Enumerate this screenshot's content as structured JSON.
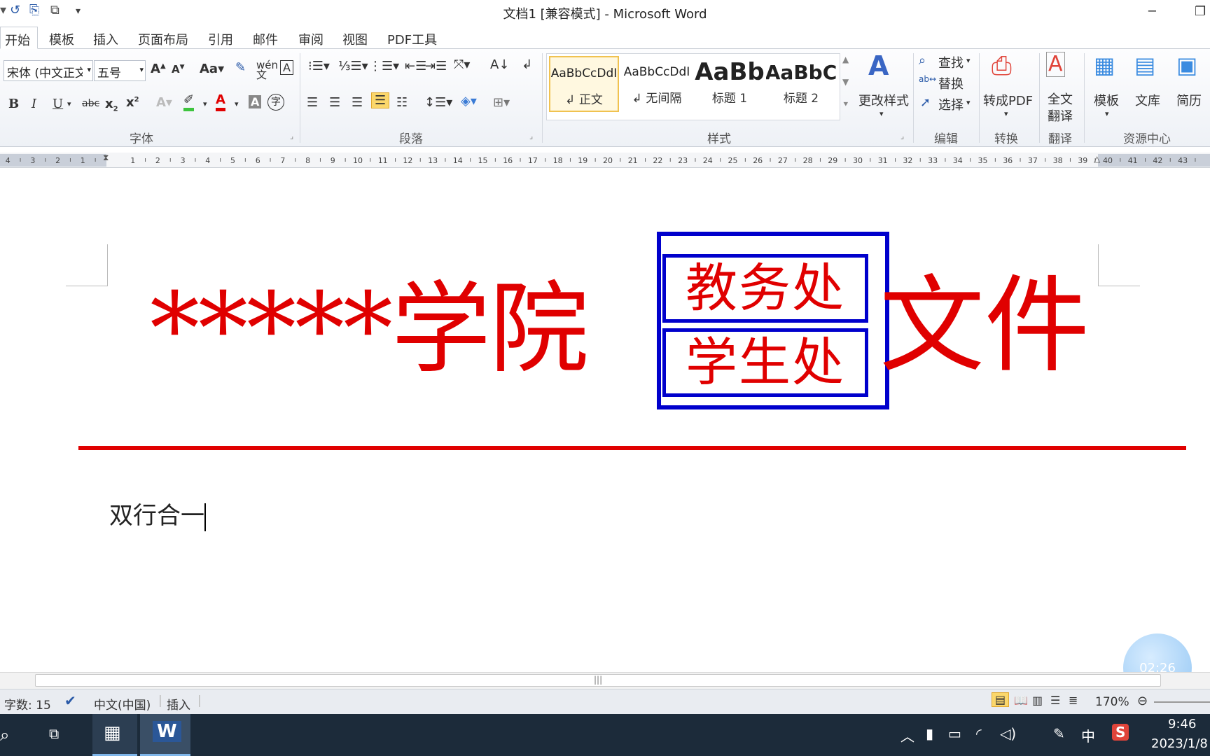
{
  "window": {
    "title": "文档1 [兼容模式] - Microsoft Word"
  },
  "tabs": [
    "开始",
    "模板",
    "插入",
    "页面布局",
    "引用",
    "邮件",
    "审阅",
    "视图",
    "PDF工具"
  ],
  "ribbon": {
    "font_name": "宋体 (中文正文)",
    "font_size": "五号",
    "groups": {
      "font": "字体",
      "paragraph": "段落",
      "styles": "样式",
      "edit": "编辑",
      "convert": "转换",
      "translate": "翻译",
      "resources": "资源中心"
    },
    "styles": [
      {
        "preview": "AaBbCcDdI",
        "name": "↲ 正文"
      },
      {
        "preview": "AaBbCcDdI",
        "name": "↲ 无间隔"
      },
      {
        "preview": "AaBb",
        "name": "标题 1"
      },
      {
        "preview": "AaBbC",
        "name": "标题 2"
      }
    ],
    "change_styles": "更改样式",
    "find": "查找",
    "replace": "替换",
    "select": "选择",
    "to_pdf": "转成PDF",
    "full_translate_1": "全文",
    "full_translate_2": "翻译",
    "templates": "模板",
    "library": "文库",
    "resume": "简历",
    "bold": "B",
    "italic": "I",
    "underline": "U"
  },
  "ruler": {
    "labels": [
      "4",
      "3",
      "2",
      "1",
      "1",
      "2",
      "3",
      "4",
      "5",
      "6",
      "7",
      "8",
      "9",
      "10",
      "11",
      "12",
      "13",
      "14",
      "15",
      "16",
      "17",
      "18",
      "19",
      "20",
      "21",
      "22",
      "23",
      "24",
      "25",
      "26",
      "27",
      "28",
      "29",
      "30",
      "31",
      "32",
      "33",
      "34",
      "35",
      "36",
      "37",
      "38",
      "39",
      "40",
      "41",
      "42",
      "43"
    ]
  },
  "document": {
    "header_left": "*****学院",
    "header_top": "教务处",
    "header_bottom": "学生处",
    "header_right": "文件",
    "body_text": "双行合一"
  },
  "status": {
    "word_count": "字数: 15",
    "language": "中文(中国)",
    "mode": "插入",
    "zoom": "170%"
  },
  "timer": "02:26",
  "taskbar": {
    "time": "9:46",
    "date": "2023/1/8",
    "ime": "中"
  },
  "colors": {
    "red": "#e00000",
    "blue": "#0000cc",
    "accent": "#2a5aa8"
  }
}
